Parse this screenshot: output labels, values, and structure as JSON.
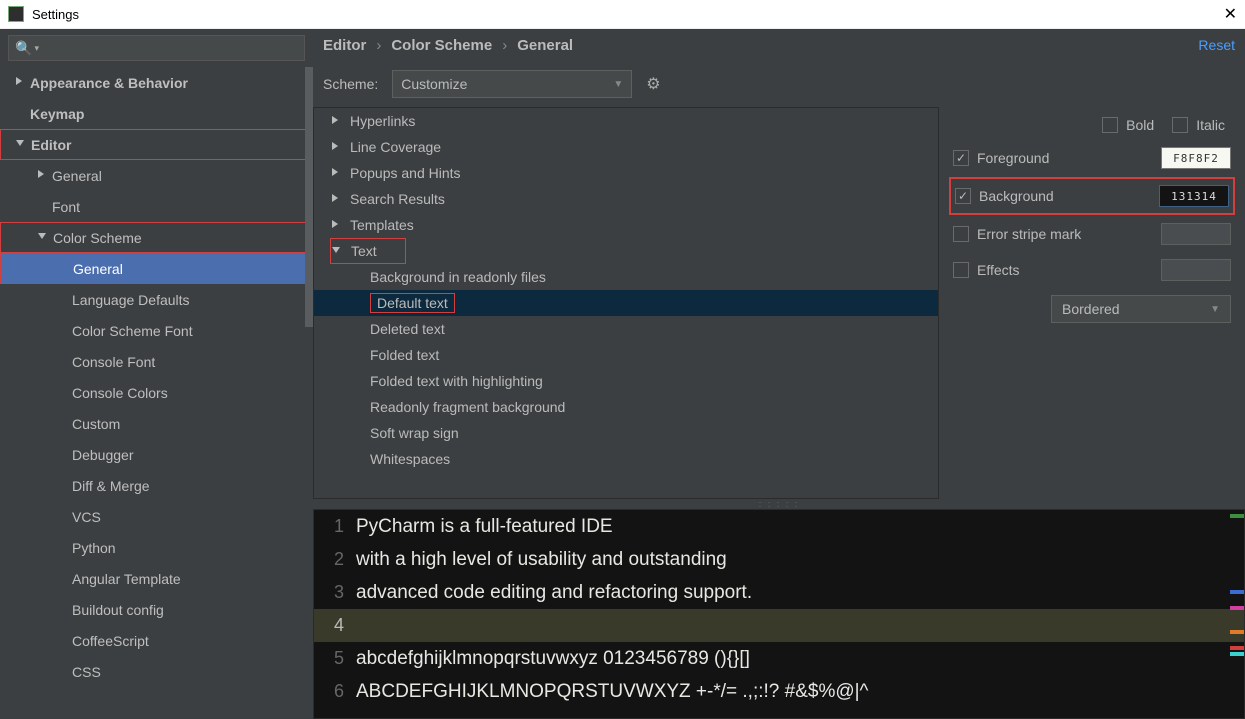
{
  "window": {
    "title": "Settings"
  },
  "sidebar": {
    "items": [
      {
        "label": "Appearance & Behavior",
        "arrow": "right",
        "bold": true,
        "indent": 0
      },
      {
        "label": "Keymap",
        "arrow": "",
        "bold": true,
        "indent": 0,
        "pad": 1
      },
      {
        "label": "Editor",
        "arrow": "down",
        "bold": true,
        "indent": 0,
        "red": true
      },
      {
        "label": "General",
        "arrow": "right",
        "bold": false,
        "indent": 1
      },
      {
        "label": "Font",
        "arrow": "",
        "bold": false,
        "indent": 1,
        "pad": 1
      },
      {
        "label": "Color Scheme",
        "arrow": "down",
        "bold": false,
        "indent": 1,
        "red": true
      },
      {
        "label": "General",
        "arrow": "",
        "bold": false,
        "indent": 2,
        "selected": true,
        "red": true,
        "pad": 1
      },
      {
        "label": "Language Defaults",
        "arrow": "",
        "bold": false,
        "indent": 2,
        "pad": 1
      },
      {
        "label": "Color Scheme Font",
        "arrow": "",
        "bold": false,
        "indent": 2,
        "pad": 1
      },
      {
        "label": "Console Font",
        "arrow": "",
        "bold": false,
        "indent": 2,
        "pad": 1
      },
      {
        "label": "Console Colors",
        "arrow": "",
        "bold": false,
        "indent": 2,
        "pad": 1
      },
      {
        "label": "Custom",
        "arrow": "",
        "bold": false,
        "indent": 2,
        "pad": 1
      },
      {
        "label": "Debugger",
        "arrow": "",
        "bold": false,
        "indent": 2,
        "pad": 1
      },
      {
        "label": "Diff & Merge",
        "arrow": "",
        "bold": false,
        "indent": 2,
        "pad": 1
      },
      {
        "label": "VCS",
        "arrow": "",
        "bold": false,
        "indent": 2,
        "pad": 1
      },
      {
        "label": "Python",
        "arrow": "",
        "bold": false,
        "indent": 2,
        "pad": 1
      },
      {
        "label": "Angular Template",
        "arrow": "",
        "bold": false,
        "indent": 2,
        "pad": 1
      },
      {
        "label": "Buildout config",
        "arrow": "",
        "bold": false,
        "indent": 2,
        "pad": 1
      },
      {
        "label": "CoffeeScript",
        "arrow": "",
        "bold": false,
        "indent": 2,
        "pad": 1
      },
      {
        "label": "CSS",
        "arrow": "",
        "bold": false,
        "indent": 2,
        "pad": 1
      }
    ]
  },
  "breadcrumbs": {
    "a": "Editor",
    "b": "Color Scheme",
    "c": "General",
    "reset": "Reset"
  },
  "scheme": {
    "label": "Scheme:",
    "value": "Customize"
  },
  "categories": [
    {
      "label": "Hyperlinks",
      "arrow": "right"
    },
    {
      "label": "Line Coverage",
      "arrow": "right"
    },
    {
      "label": "Popups and Hints",
      "arrow": "right"
    },
    {
      "label": "Search Results",
      "arrow": "right"
    },
    {
      "label": "Templates",
      "arrow": "right"
    },
    {
      "label": "Text",
      "arrow": "down",
      "red": true
    }
  ],
  "text_children": [
    {
      "label": "Background in readonly files"
    },
    {
      "label": "Default text",
      "selected": true,
      "red": true
    },
    {
      "label": "Deleted text"
    },
    {
      "label": "Folded text"
    },
    {
      "label": "Folded text with highlighting"
    },
    {
      "label": "Readonly fragment background"
    },
    {
      "label": "Soft wrap sign"
    },
    {
      "label": "Whitespaces"
    }
  ],
  "attrs": {
    "bold": "Bold",
    "italic": "Italic",
    "foreground": "Foreground",
    "fg_val": "F8F8F2",
    "background": "Background",
    "bg_val": "131314",
    "stripe": "Error stripe mark",
    "effects": "Effects",
    "effect_type": "Bordered"
  },
  "preview": {
    "lines": [
      "PyCharm is a full-featured IDE",
      "with a high level of usability and outstanding",
      "advanced code editing and refactoring support.",
      "",
      "abcdefghijklmnopqrstuvwxyz 0123456789 (){}[]",
      "ABCDEFGHIJKLMNOPQRSTUVWXYZ +-*/= .,;:!? #&$%@|^"
    ]
  }
}
